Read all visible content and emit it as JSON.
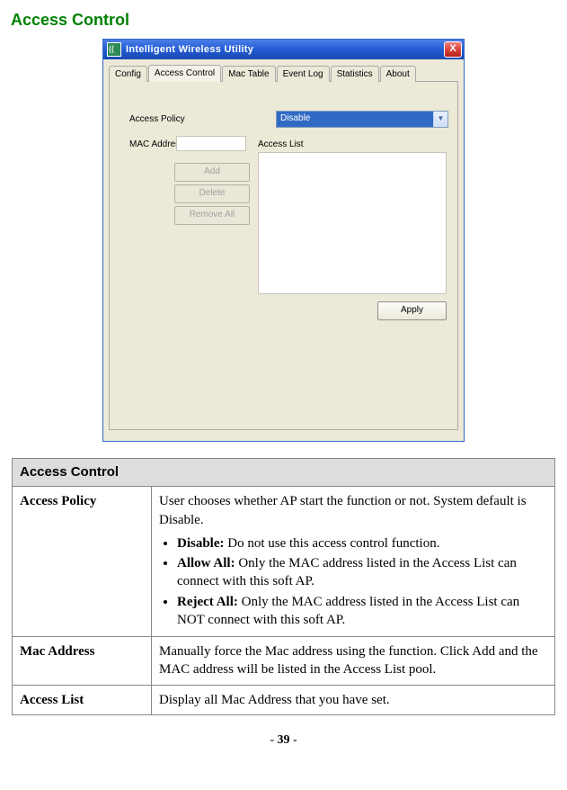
{
  "page": {
    "title": "Access Control",
    "footer_prefix": "- ",
    "footer_page": "39",
    "footer_suffix": " -"
  },
  "window": {
    "title": "Intelligent Wireless Utility",
    "tabs": [
      "Config",
      "Access Control",
      "Mac Table",
      "Event Log",
      "Statistics",
      "About"
    ],
    "active_tab": 1,
    "labels": {
      "policy": "Access Policy",
      "mac": "MAC Address",
      "list": "Access List"
    },
    "combo_value": "Disable",
    "buttons": {
      "add": "Add",
      "delete": "Delete",
      "remove_all": "Remove All",
      "apply": "Apply"
    }
  },
  "table": {
    "header": "Access Control",
    "rows": [
      {
        "label": "Access Policy",
        "intro": "User chooses whether AP start the function or not. System default is Disable.",
        "options": [
          {
            "name": "Disable:",
            "desc": " Do not use this access control function."
          },
          {
            "name": "Allow All:",
            "desc": " Only the MAC address listed in the Access List can connect with this soft AP."
          },
          {
            "name": "Reject All:",
            "desc": " Only the MAC address listed in the Access List can NOT connect with this soft AP."
          }
        ]
      },
      {
        "label": "Mac Address",
        "desc": "Manually force the Mac address using the function. Click Add and the MAC address will be listed in the Access List pool."
      },
      {
        "label": "Access List",
        "desc": "Display all Mac Address that you have set."
      }
    ]
  }
}
